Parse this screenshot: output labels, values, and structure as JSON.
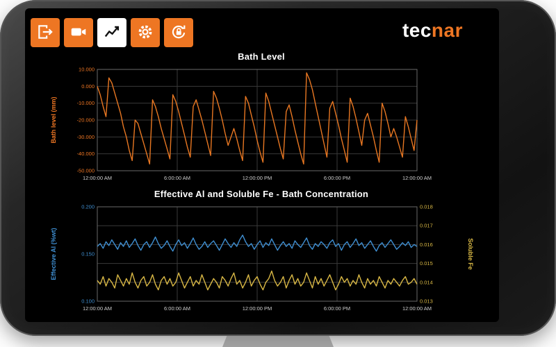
{
  "device": {
    "brand_text_primary": "tec",
    "brand_text_secondary": "nar"
  },
  "toolbar": {
    "buttons": [
      {
        "icon": "logout-icon",
        "active": false
      },
      {
        "icon": "camera-icon",
        "active": false
      },
      {
        "icon": "trend-chart-icon",
        "active": true
      },
      {
        "icon": "gear-icon",
        "active": false
      },
      {
        "icon": "lock-refresh-icon",
        "active": false
      }
    ]
  },
  "colors": {
    "accent": "#ee7623",
    "bath_line": "#e87722",
    "al_line": "#3f8fd2",
    "fe_line": "#d9b845",
    "grid": "#3a3a3a",
    "axis_border": "#6a6a6a",
    "x_tick": "#cfcfcf",
    "title": "#ffffff"
  },
  "chart_data": [
    {
      "type": "line",
      "title": "Bath Level",
      "ylabel": "Bath level (mm)",
      "xlabel": "",
      "x_ticks": [
        "12:00:00 AM",
        "6:00:00 AM",
        "12:00:00 PM",
        "6:00:00 PM",
        "12:00:00 AM"
      ],
      "x_range_hours": 24,
      "ylim": [
        -50,
        10
      ],
      "y_ticks": [
        "10.000",
        "0.000",
        "-10.000",
        "-20.000",
        "-30.000",
        "-40.000",
        "-50.000"
      ],
      "grid": true,
      "series": [
        {
          "name": "Bath level",
          "color": "#e87722",
          "values": [
            0,
            -5,
            -12,
            -18,
            5,
            2,
            -4,
            -10,
            -16,
            -24,
            -30,
            -38,
            -44,
            -20,
            -22,
            -28,
            -34,
            -40,
            -46,
            -8,
            -12,
            -18,
            -25,
            -31,
            -37,
            -43,
            -5,
            -9,
            -15,
            -22,
            -29,
            -36,
            -42,
            -12,
            -8,
            -14,
            -20,
            -27,
            -34,
            -41,
            -3,
            -7,
            -13,
            -20,
            -28,
            -35,
            -30,
            -25,
            -31,
            -38,
            -44,
            -6,
            -10,
            -17,
            -24,
            -32,
            -39,
            -45,
            -4,
            -9,
            -16,
            -23,
            -30,
            -37,
            -43,
            -15,
            -11,
            -18,
            -26,
            -33,
            -40,
            -46,
            8,
            4,
            -2,
            -10,
            -18,
            -26,
            -34,
            -42,
            -13,
            -9,
            -16,
            -23,
            -31,
            -38,
            -45,
            -7,
            -12,
            -19,
            -27,
            -35,
            -20,
            -16,
            -23,
            -30,
            -38,
            -45,
            -10,
            -15,
            -22,
            -30,
            -25,
            -30,
            -36,
            -42,
            -18,
            -24,
            -31,
            -38,
            -20
          ]
        }
      ]
    },
    {
      "type": "line",
      "title": "Effective Al and Soluble Fe - Bath Concentration",
      "ylabel_left": "Effective Al (%wt)",
      "ylabel_right": "Soluble Fe",
      "xlabel": "",
      "x_ticks": [
        "12:00:00 AM",
        "6:00:00 AM",
        "12:00:00 PM",
        "6:00:00 PM",
        "12:00:00 AM"
      ],
      "x_range_hours": 24,
      "ylim_left": [
        0.1,
        0.2
      ],
      "y_ticks_left": [
        "0.200",
        "0.150",
        "0.100"
      ],
      "ylim_right": [
        0.013,
        0.018
      ],
      "y_ticks_right": [
        "0.018",
        "0.017",
        "0.016",
        "0.015",
        "0.014",
        "0.013"
      ],
      "grid": true,
      "series": [
        {
          "name": "Effective Al",
          "axis": "left",
          "color": "#3f8fd2",
          "values": [
            0.158,
            0.161,
            0.156,
            0.163,
            0.159,
            0.165,
            0.16,
            0.155,
            0.162,
            0.158,
            0.164,
            0.157,
            0.161,
            0.166,
            0.159,
            0.154,
            0.16,
            0.163,
            0.157,
            0.162,
            0.168,
            0.161,
            0.156,
            0.159,
            0.164,
            0.158,
            0.153,
            0.16,
            0.165,
            0.159,
            0.162,
            0.156,
            0.161,
            0.167,
            0.16,
            0.155,
            0.158,
            0.163,
            0.157,
            0.161,
            0.164,
            0.159,
            0.154,
            0.16,
            0.166,
            0.161,
            0.157,
            0.162,
            0.158,
            0.165,
            0.17,
            0.163,
            0.158,
            0.161,
            0.155,
            0.16,
            0.164,
            0.157,
            0.162,
            0.159,
            0.166,
            0.16,
            0.154,
            0.159,
            0.163,
            0.158,
            0.161,
            0.156,
            0.164,
            0.16,
            0.157,
            0.162,
            0.167,
            0.159,
            0.155,
            0.161,
            0.158,
            0.163,
            0.16,
            0.156,
            0.162,
            0.165,
            0.158,
            0.161,
            0.154,
            0.16,
            0.163,
            0.157,
            0.161,
            0.166,
            0.159,
            0.162,
            0.156,
            0.16,
            0.164,
            0.158,
            0.153,
            0.159,
            0.162,
            0.157,
            0.161,
            0.165,
            0.16,
            0.155,
            0.158,
            0.162,
            0.159,
            0.163,
            0.157,
            0.16,
            0.158
          ]
        },
        {
          "name": "Soluble Fe",
          "axis": "right",
          "color": "#d9b845",
          "values": [
            0.0141,
            0.0139,
            0.0143,
            0.0138,
            0.0142,
            0.014,
            0.0137,
            0.0144,
            0.0141,
            0.0138,
            0.0142,
            0.0139,
            0.0145,
            0.014,
            0.0137,
            0.0141,
            0.0143,
            0.0138,
            0.014,
            0.0144,
            0.0139,
            0.0136,
            0.0141,
            0.0143,
            0.0139,
            0.0142,
            0.0138,
            0.014,
            0.0145,
            0.0141,
            0.0137,
            0.014,
            0.0143,
            0.0138,
            0.0141,
            0.0139,
            0.0144,
            0.014,
            0.0136,
            0.0139,
            0.0142,
            0.014,
            0.0137,
            0.0143,
            0.0141,
            0.0138,
            0.0142,
            0.0145,
            0.0139,
            0.0141,
            0.0137,
            0.014,
            0.0144,
            0.0138,
            0.0141,
            0.0143,
            0.0139,
            0.0136,
            0.014,
            0.0142,
            0.0146,
            0.0141,
            0.0138,
            0.014,
            0.0143,
            0.0137,
            0.0141,
            0.0144,
            0.0139,
            0.0142,
            0.0138,
            0.014,
            0.0145,
            0.0141,
            0.0137,
            0.0143,
            0.0139,
            0.0142,
            0.0138,
            0.0141,
            0.0144,
            0.014,
            0.0136,
            0.0139,
            0.0143,
            0.014,
            0.0142,
            0.0138,
            0.0141,
            0.0139,
            0.0144,
            0.014,
            0.0137,
            0.0142,
            0.0139,
            0.0141,
            0.0138,
            0.0143,
            0.014,
            0.0137,
            0.0141,
            0.0139,
            0.0142,
            0.014,
            0.0138,
            0.0141,
            0.0143,
            0.0139,
            0.014,
            0.0142,
            0.0139
          ]
        }
      ]
    }
  ]
}
